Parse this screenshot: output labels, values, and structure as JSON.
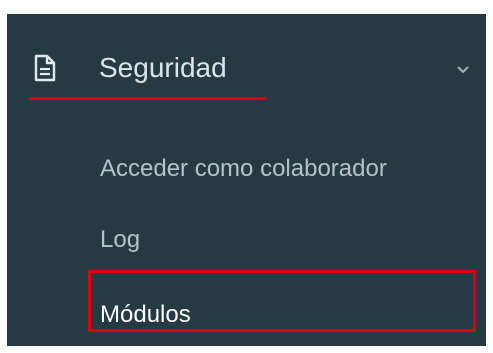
{
  "menu": {
    "section_label": "Seguridad",
    "icons": {
      "section": "document-icon",
      "expand": "chevron-down-icon"
    },
    "expanded": true,
    "items": [
      {
        "label": "Acceder como colaborador",
        "active": false
      },
      {
        "label": "Log",
        "active": false
      },
      {
        "label": "Módulos",
        "active": true
      }
    ]
  },
  "colors": {
    "panel_background": "#253a43",
    "section_text": "#dde4e8",
    "item_text": "#b5c2c9",
    "annotation": "#e00000"
  }
}
